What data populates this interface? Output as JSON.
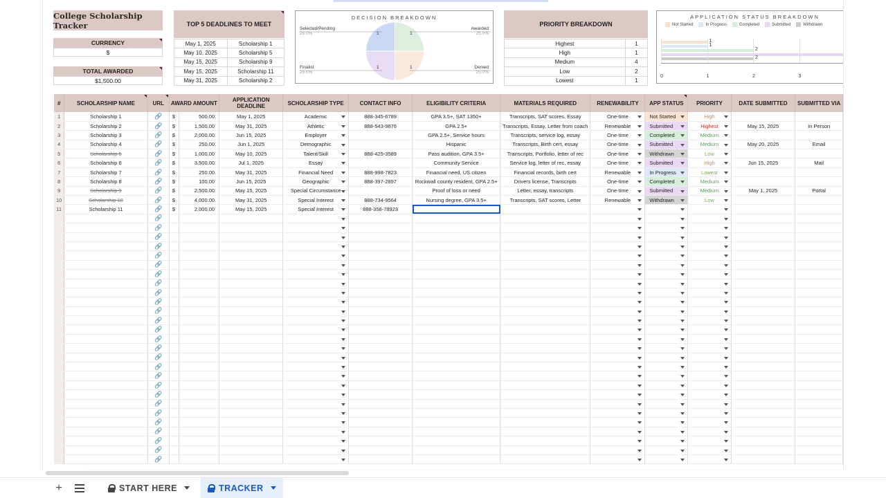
{
  "title": "College Scholarship Tracker",
  "currency": {
    "label": "CURRENCY",
    "value": "$"
  },
  "total_awarded": {
    "label": "TOTAL AWARDED",
    "value": "$1,500.00"
  },
  "deadlines": {
    "title": "TOP 5 DEADLINES TO MEET",
    "rows": [
      {
        "date": "May 1, 2025",
        "name": "Scholarship 1"
      },
      {
        "date": "May 10, 2025",
        "name": "Scholarship 5"
      },
      {
        "date": "May 15, 2025",
        "name": "Scholarship 9"
      },
      {
        "date": "May 15, 2025",
        "name": "Scholarship 11"
      },
      {
        "date": "May 31, 2025",
        "name": "Scholarship 2"
      }
    ]
  },
  "decision_chart": {
    "title": "DECISION BREAKDOWN",
    "slices": [
      {
        "label": "Selected/Pending",
        "pct": "25.0%",
        "count": "1",
        "color": "#c9d8f5"
      },
      {
        "label": "Awarded",
        "pct": "25.0%",
        "count": "1",
        "color": "#dceee0"
      },
      {
        "label": "Finalist",
        "pct": "25.0%",
        "count": "1",
        "color": "#e8dcf5"
      },
      {
        "label": "Denied",
        "pct": "25.0%",
        "count": "1",
        "color": "#fae8dc"
      }
    ]
  },
  "priority": {
    "title": "PRIORITY BREAKDOWN",
    "rows": [
      {
        "level": "Highest",
        "count": "1"
      },
      {
        "level": "High",
        "count": "1"
      },
      {
        "level": "Medium",
        "count": "4"
      },
      {
        "level": "Low",
        "count": "2"
      },
      {
        "level": "Lowest",
        "count": "1"
      }
    ]
  },
  "status_chart": {
    "title": "APPLICATION STATUS BREAKDOWN",
    "legend": [
      {
        "name": "Not Started",
        "color": "#fae0cc"
      },
      {
        "name": "In Progress",
        "color": "#dde7f7"
      },
      {
        "name": "Completed",
        "color": "#d6ecde"
      },
      {
        "name": "Submitted",
        "color": "#e6d6f3"
      },
      {
        "name": "Withdrawn",
        "color": "#cccccc"
      }
    ],
    "ticks": [
      "0",
      "1",
      "2",
      "3"
    ],
    "values": [
      1,
      1,
      2,
      4,
      2
    ],
    "labels": [
      "1",
      "1",
      "2",
      "",
      "2"
    ]
  },
  "columns": [
    "#",
    "SCHOLARSHIP NAME",
    "URL",
    "AWARD AMOUNT",
    "APPLICATION DEADLINE",
    "SCHOLARSHIP TYPE",
    "CONTACT INFO",
    "ELIGIBILITY CRITERIA",
    "MATERIALS REQUIRED",
    "RENEWABILITY",
    "APP STATUS",
    "PRIORITY",
    "DATE SUBMITTED",
    "SUBMITTED VIA"
  ],
  "rows": [
    {
      "num": "1",
      "name": "Scholarship 1",
      "strike": false,
      "amount": "500.00",
      "deadline": "May 1, 2025",
      "type": "Academic",
      "contact": "888-345-6789",
      "elig": "GPA 3.5+, SAT 1350+",
      "materials": "Transcripts, SAT scores, Essay",
      "renew": "One-time",
      "status": "Not Started",
      "status_bg": "#fbe3d2",
      "priority": "High",
      "pcolor": "#d98a3a",
      "submitted": "",
      "via": ""
    },
    {
      "num": "2",
      "name": "Scholarship 2",
      "strike": false,
      "amount": "1,500.00",
      "deadline": "May 31, 2025",
      "type": "Athletic",
      "contact": "888-543-9876",
      "elig": "GPA 2.5+",
      "materials": "Transcripts, Essay, Letter from coach",
      "renew": "Renewable",
      "status": "Submitted",
      "status_bg": "#ead9f4",
      "priority": "Highest",
      "pcolor": "#c0392b",
      "submitted": "May 15, 2025",
      "via": "In Person"
    },
    {
      "num": "3",
      "name": "Scholarship 3",
      "strike": false,
      "amount": "2,000.00",
      "deadline": "Jun 15, 2025",
      "type": "Employer",
      "contact": "",
      "elig": "GPA 2.5+, Service hours",
      "materials": "Transcripts, service log, essay",
      "renew": "One-time",
      "status": "Completed",
      "status_bg": "#d7eedd",
      "priority": "Medium",
      "pcolor": "#5aa05a",
      "submitted": "",
      "via": ""
    },
    {
      "num": "4",
      "name": "Scholarship 4",
      "strike": false,
      "amount": "250.00",
      "deadline": "Jun 1, 2025",
      "type": "Demographic",
      "contact": "",
      "elig": "Hispanic",
      "materials": "Transcripts, Birth cert, essay",
      "renew": "One-time",
      "status": "Submitted",
      "status_bg": "#ead9f4",
      "priority": "Medium",
      "pcolor": "#5aa05a",
      "submitted": "May 20, 2025",
      "via": "Email"
    },
    {
      "num": "5",
      "name": "Scholarship 5",
      "strike": true,
      "amount": "1,000.00",
      "deadline": "May 10, 2025",
      "type": "Talent/Skill",
      "contact": "888-425-3589",
      "elig": "Pass audition, GPA 3.5+",
      "materials": "Transcripts, Portfolio, letter of rec",
      "renew": "One-time",
      "status": "Withdrawn",
      "status_bg": "#d4d4d4",
      "priority": "Low",
      "pcolor": "#6fae4a",
      "submitted": "",
      "via": ""
    },
    {
      "num": "6",
      "name": "Scholarship 6",
      "strike": false,
      "amount": "3,500.00",
      "deadline": "Jul 1, 2025",
      "type": "Essay",
      "contact": "",
      "elig": "Community Service",
      "materials": "Service log, letter of rec, essay",
      "renew": "One-time",
      "status": "Submitted",
      "status_bg": "#ead9f4",
      "priority": "High",
      "pcolor": "#d98a3a",
      "submitted": "Jun 15, 2025",
      "via": "Mail"
    },
    {
      "num": "7",
      "name": "Scholarship 7",
      "strike": false,
      "amount": "250.00",
      "deadline": "May 31, 2025",
      "type": "Financial Need",
      "contact": "888-998-7823",
      "elig": "Financial need, US citizen",
      "materials": "Financial records, birth cert",
      "renew": "Renewable",
      "status": "In Progress",
      "status_bg": "#dfe8f8",
      "priority": "Lowest",
      "pcolor": "#6fae4a",
      "submitted": "",
      "via": ""
    },
    {
      "num": "8",
      "name": "Scholarship 8",
      "strike": false,
      "amount": "100.00",
      "deadline": "Jun 15, 2025",
      "type": "Geographic",
      "contact": "888-397-2897",
      "elig": "Rockwall county resident, GPA 2.5+",
      "materials": "Drivers license, Transcripts",
      "renew": "One-time",
      "status": "Completed",
      "status_bg": "#d7eedd",
      "priority": "Medium",
      "pcolor": "#5aa05a",
      "submitted": "",
      "via": ""
    },
    {
      "num": "9",
      "name": "Scholarship 9",
      "strike": true,
      "amount": "2,500.00",
      "deadline": "May 15, 2025",
      "type": "Special Circumstance",
      "contact": "",
      "elig": "Proof of loss or need",
      "materials": "Letter, essay, transcripts",
      "renew": "One-time",
      "status": "Submitted",
      "status_bg": "#ead9f4",
      "priority": "Medium",
      "pcolor": "#5aa05a",
      "submitted": "May 1, 2025",
      "via": "Portal"
    },
    {
      "num": "10",
      "name": "Scholarship 10",
      "strike": true,
      "amount": "4,000.00",
      "deadline": "May 31, 2025",
      "type": "Special Interest",
      "contact": "888-734-9564",
      "elig": "Nursing degree, GPA 3.5+",
      "materials": "Transcripts, SAT scores, Letter",
      "renew": "Renewable",
      "status": "Withdrawn",
      "status_bg": "#d4d4d4",
      "priority": "Low",
      "pcolor": "#6fae4a",
      "submitted": "",
      "via": ""
    },
    {
      "num": "11",
      "name": "Scholarship 11",
      "strike": false,
      "amount": "2,000.00",
      "deadline": "May 15, 2025",
      "type": "Special Interest",
      "contact": "888-358-78923",
      "elig": "",
      "materials": "",
      "renew": "",
      "status": "",
      "status_bg": "",
      "priority": "",
      "pcolor": "",
      "submitted": "",
      "via": ""
    }
  ],
  "empty_rows": 27,
  "tabs": {
    "start": "START HERE",
    "tracker": "TRACKER"
  },
  "icons": {
    "add_sheet": "plus-icon",
    "all_sheets": "menu-icon",
    "lock": "lock-icon",
    "url": "link-icon"
  }
}
